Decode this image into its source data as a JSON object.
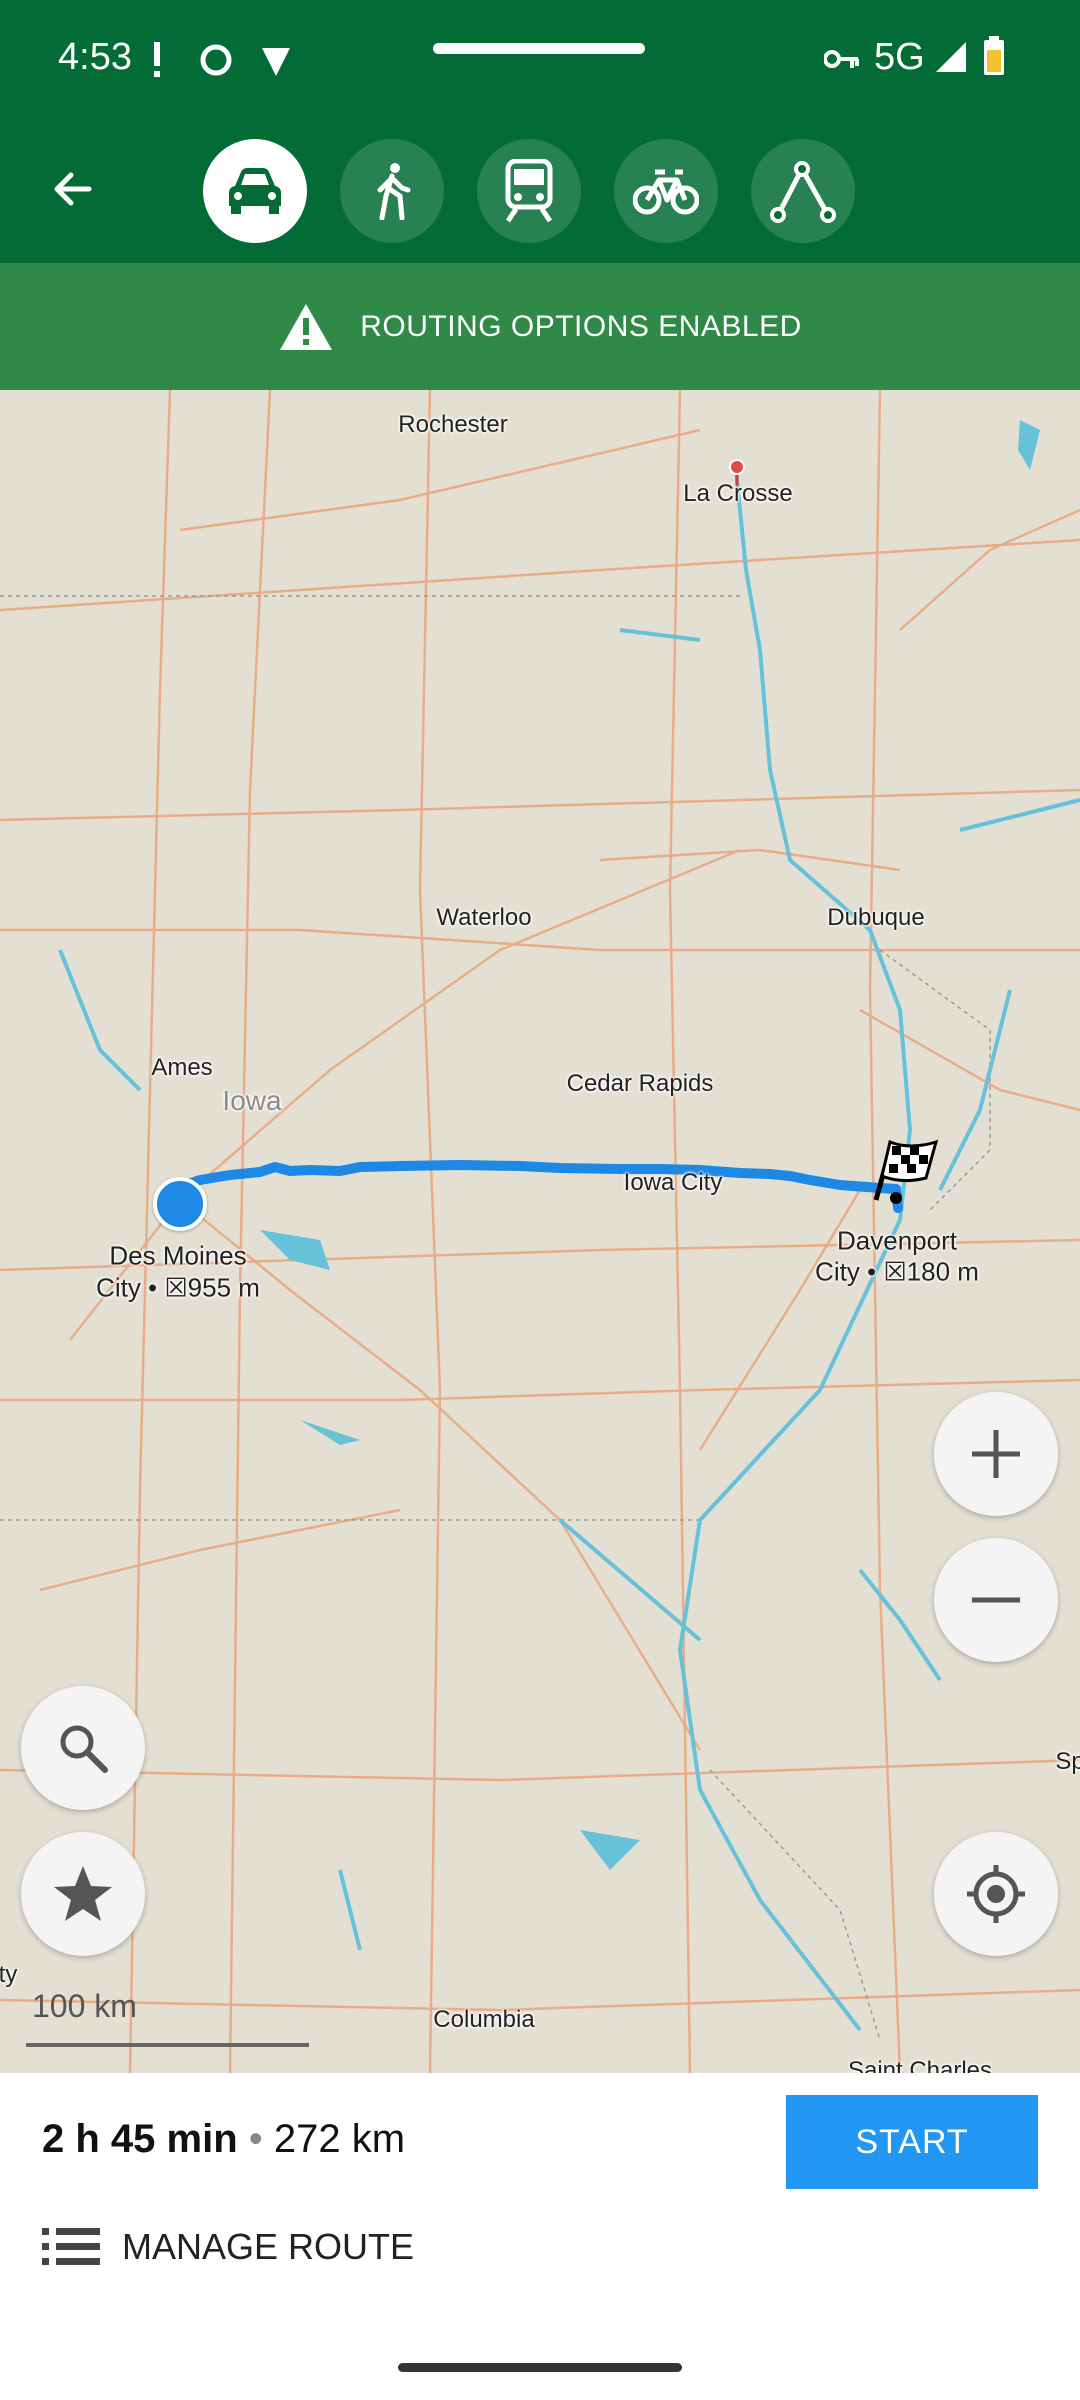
{
  "status_bar": {
    "time": "4:53",
    "network": "5G"
  },
  "toolbar": {
    "back_icon": "arrow-back-icon",
    "modes": [
      {
        "name": "car",
        "icon": "car-icon",
        "active": true
      },
      {
        "name": "walk",
        "icon": "pedestrian-icon",
        "active": false
      },
      {
        "name": "transit",
        "icon": "train-icon",
        "active": false
      },
      {
        "name": "bike",
        "icon": "bicycle-icon",
        "active": false
      },
      {
        "name": "ruler",
        "icon": "route-ruler-icon",
        "active": false
      }
    ]
  },
  "banner": {
    "text": "ROUTING OPTIONS ENABLED",
    "icon": "warning-icon"
  },
  "map": {
    "places": {
      "rochester": "Rochester",
      "la_crosse": "La Crosse",
      "waterloo": "Waterloo",
      "dubuque": "Dubuque",
      "ames": "Ames",
      "iowa": "Iowa",
      "cedar_rapids": "Cedar Rapids",
      "iowa_city": "Iowa City",
      "columbia": "Columbia",
      "saint_charles": "Saint Charles",
      "sp": "Sp",
      "ty": "ty"
    },
    "origin": {
      "name": "Des Moines",
      "detail": "City • ☒955 m"
    },
    "destination": {
      "name": "Davenport",
      "detail": "City • ☒180 m"
    },
    "scale_label": "100 km"
  },
  "route_summary": {
    "duration": "2 h 45 min",
    "separator": "•",
    "distance": "272 km"
  },
  "buttons": {
    "start": "START",
    "manage_route": "MANAGE ROUTE"
  },
  "colors": {
    "toolbar": "#036b35",
    "banner": "#2f8a48",
    "route": "#1e88e5",
    "start": "#2196f3"
  }
}
